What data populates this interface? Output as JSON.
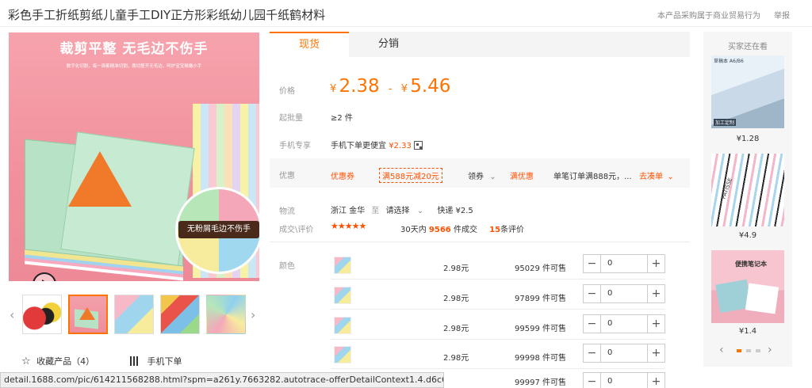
{
  "header": {
    "title": "彩色手工折纸剪纸儿童手工DIY正方形彩纸幼儿园千纸鹤材料",
    "trade_note": "本产品采购属于商业贸易行为",
    "report": "举报"
  },
  "gallery": {
    "banner": "裁剪平整 无毛边不伤手",
    "subtitle": "数字化切割，每一面都精准切割，裁切整齐无毛边，呵护宝宝稚嫩小手",
    "badge_text": "无粉屑毛边不伤手",
    "thumb_count": 5,
    "selected_thumb": 2
  },
  "actions": {
    "favorite": "收藏产品（4）",
    "mobile_order": "手机下单"
  },
  "tabs": [
    "现货",
    "分销"
  ],
  "price": {
    "label": "价格",
    "currency": "¥",
    "low": "2.38",
    "sep": "-",
    "high": "5.46"
  },
  "moq": {
    "label": "起批量",
    "value": "≥2 件"
  },
  "mobile": {
    "label": "手机专享",
    "text": "手机下单更便宜",
    "price": "¥2.33"
  },
  "promo": {
    "label": "优惠",
    "coupon": "优惠券",
    "coupon_value": "满588元减20元",
    "get": "领券",
    "full_discount": "满优惠",
    "full_text": "单笔订单满888元，...",
    "go_order": "去凑单"
  },
  "logistics": {
    "label": "物流",
    "from": "浙江 金华",
    "to_word": "至",
    "select": "请选择",
    "express": "快递 ¥2.5"
  },
  "reviews": {
    "label": "成交\\评价",
    "stars": "★★★★★",
    "deals_prefix": "30天内",
    "deals_count": "9566",
    "deals_suffix": "件成交",
    "review_count": "15",
    "review_suffix": "条评价"
  },
  "sku": {
    "label": "颜色",
    "rows": [
      {
        "price": "2.98元",
        "stock": "95029 件可售",
        "qty": "0"
      },
      {
        "price": "2.98元",
        "stock": "97899 件可售",
        "qty": "0"
      },
      {
        "price": "2.98元",
        "stock": "99599 件可售",
        "qty": "0"
      },
      {
        "price": "2.98元",
        "stock": "99998 件可售",
        "qty": "0"
      },
      {
        "price": "",
        "stock": "99997 件可售",
        "qty": "0"
      }
    ]
  },
  "sidebar": {
    "heading": "买家还在看",
    "items": [
      {
        "price": "¥1.28",
        "caption": "草稿本 A6/B6",
        "caption2": "加工定制"
      },
      {
        "price": "¥4.9",
        "caption": "PATISSE"
      },
      {
        "price": "¥1.4",
        "caption": "便携笔记本"
      }
    ]
  },
  "statusbar": {
    "url": "detail.1688.com/pic/614211568288.html?spm=a261y.7663282.autotrace-offerDetailContext1.4.d6c663f0tLsLV1"
  },
  "colors": {
    "accent": "#ff7300",
    "promo_red": "#ff5000"
  }
}
